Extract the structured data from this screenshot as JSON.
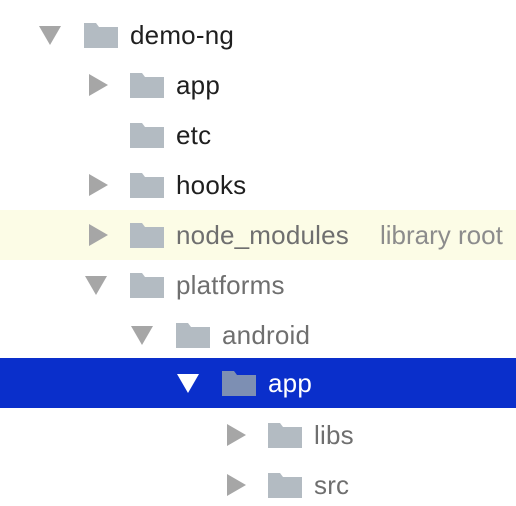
{
  "tree": {
    "rows": [
      {
        "label": "demo-ng",
        "expanded": true
      },
      {
        "label": "app",
        "expanded": false
      },
      {
        "label": "etc"
      },
      {
        "label": "hooks",
        "expanded": false
      },
      {
        "label": "node_modules",
        "extra": "library root",
        "expanded": false
      },
      {
        "label": "platforms",
        "expanded": true
      },
      {
        "label": "android",
        "expanded": true
      },
      {
        "label": "app",
        "expanded": true,
        "selected": true
      },
      {
        "label": "libs",
        "expanded": false
      },
      {
        "label": "src",
        "expanded": false
      }
    ]
  },
  "colors": {
    "selection": "#0a2fcb",
    "library_row": "#fcfce6",
    "folder": "#b3bbc2",
    "toggle": "#a6a6a6"
  },
  "icons": {
    "folder": "folder-icon",
    "expanded": "expand-triangle-down-icon",
    "collapsed": "expand-triangle-right-icon"
  }
}
